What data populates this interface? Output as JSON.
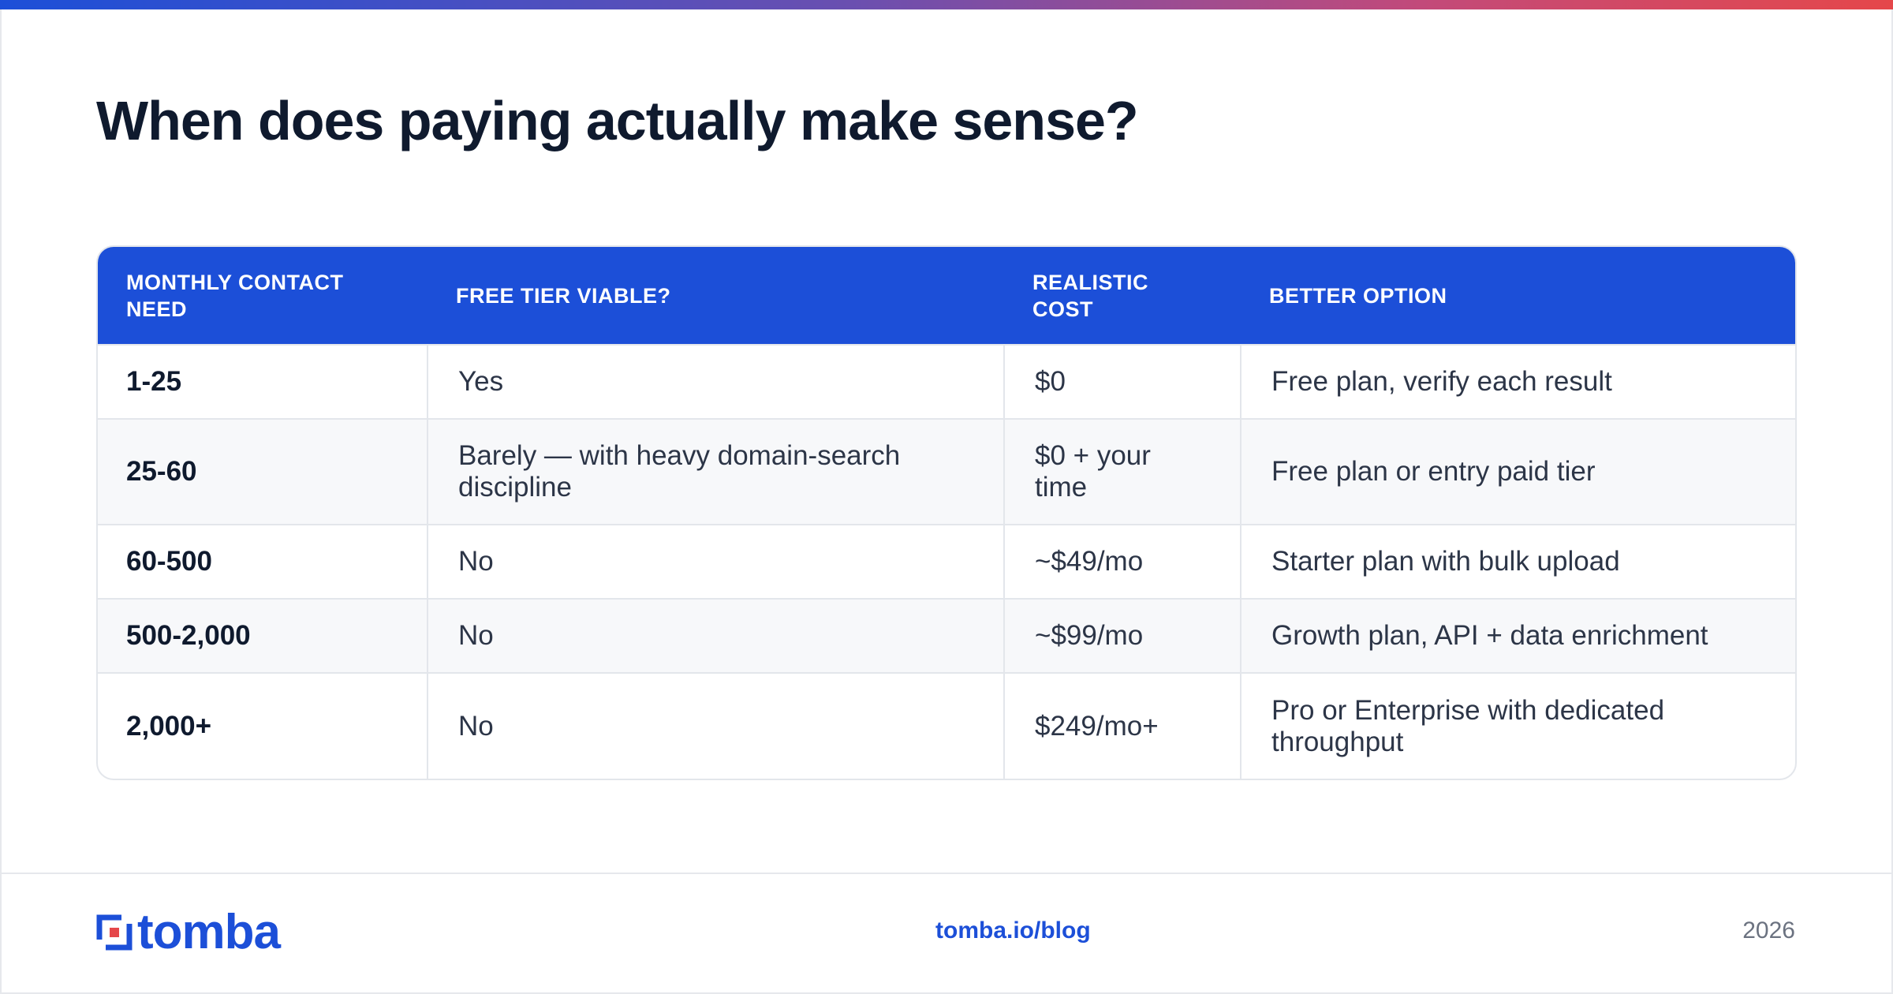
{
  "title": "When does paying actually make sense?",
  "colors": {
    "accent": "#1c4fd8",
    "title": "#0f1a2e",
    "stripe": "#f7f8fa"
  },
  "table": {
    "headers": [
      "MONTHLY CONTACT NEED",
      "FREE TIER VIABLE?",
      "REALISTIC COST",
      "BETTER OPTION"
    ],
    "rows": [
      [
        "1-25",
        "Yes",
        "$0",
        "Free plan, verify each result"
      ],
      [
        "25-60",
        "Barely — with heavy domain-search discipline",
        "$0 + your time",
        "Free plan or entry paid tier"
      ],
      [
        "60-500",
        "No",
        "~$49/mo",
        "Starter plan with bulk upload"
      ],
      [
        "500-2,000",
        "No",
        "~$99/mo",
        "Growth plan, API + data enrichment"
      ],
      [
        "2,000+",
        "No",
        "$249/mo+",
        "Pro or Enterprise with dedicated throughput"
      ]
    ]
  },
  "footer": {
    "logo_text": "tomba",
    "logo_icon": "tomba-logo-icon",
    "link": "tomba.io/blog",
    "year": "2026"
  }
}
